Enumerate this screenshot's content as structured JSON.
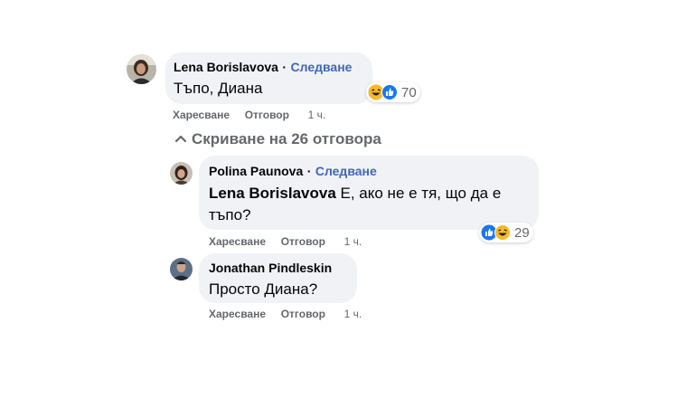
{
  "comments": [
    {
      "author": "Lena Borislavova",
      "separator": "·",
      "follow_label": "Следване",
      "text": "Тъпо, Диана",
      "reaction_icons": [
        "haha-icon",
        "like-icon"
      ],
      "reaction_count": "70",
      "like_label": "Харесване",
      "reply_label": "Отговор",
      "time": "1 ч."
    }
  ],
  "replies_toggle": {
    "chevron": "⌃",
    "label": "Скриване на 26 отговора"
  },
  "replies": [
    {
      "author": "Polina Paunova",
      "separator": "·",
      "follow_label": "Следване",
      "mention": "Lena Borislavova",
      "text_line1": "Е, ако не е тя, що да е",
      "text_line2": "тъпо?",
      "reaction_icons": [
        "like-icon",
        "haha-icon"
      ],
      "reaction_count": "29",
      "like_label": "Харесване",
      "reply_label": "Отговор",
      "time": "1 ч."
    },
    {
      "author": "Jonathan Pindleskin",
      "text": "Просто Диана?",
      "like_label": "Харесване",
      "reply_label": "Отговор",
      "time": "1 ч."
    }
  ],
  "colors": {
    "bubble": "#f0f2f5",
    "link": "#4267b2",
    "muted": "#65676b",
    "like_blue": "#1877f2",
    "haha_yellow": "#f7b928"
  }
}
